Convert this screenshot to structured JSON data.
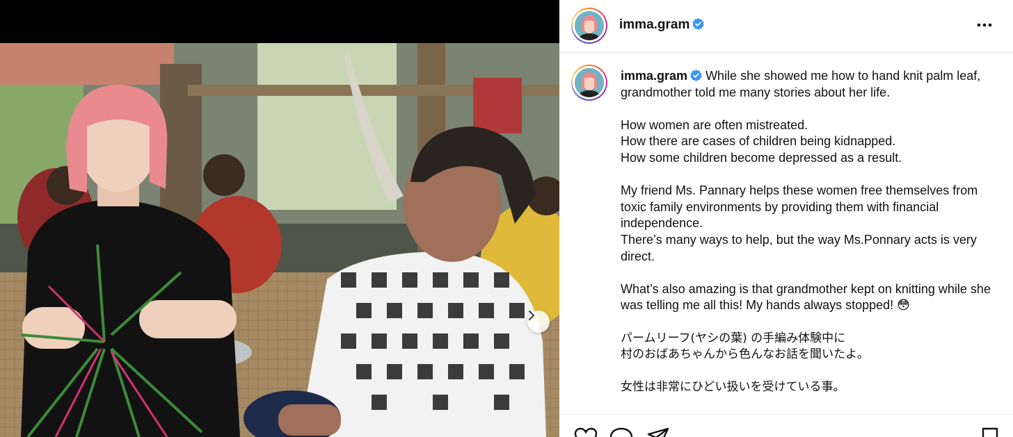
{
  "post": {
    "username": "imma.gram",
    "verified": true,
    "caption": {
      "line1": "While she showed me how to hand knit palm leaf, grandmother told me many stories about her life.",
      "para2": "How women are often mistreated.\nHow there are cases of children being kidnapped.\nHow some children become depressed as a result.",
      "para3": "My friend Ms. Pannary helps these women free themselves from toxic family environments by providing them with financial independence.\nThere’s many ways to help, but the way Ms.Ponnary acts is very direct.",
      "para4": "What’s also amazing is that grandmother kept on knitting while she was telling me all this! My hands always stopped! 😳",
      "para5": "パームリーフ(ヤシの葉) の手編み体験中に\n村のおばあちゃんから色んなお話を聞いたよ。",
      "para6": "女性は非常にひどい扱いを受けている事。"
    }
  },
  "icons": {
    "verified": "verified-badge-icon",
    "more": "more-options-icon",
    "next": "chevron-right-icon",
    "like": "heart-icon",
    "comment": "comment-icon",
    "share": "paper-plane-icon",
    "save": "bookmark-icon"
  },
  "colors": {
    "verified": "#3897f0",
    "avatar_hair": "#e98a8f",
    "avatar_bg": "#6fb4c4"
  }
}
